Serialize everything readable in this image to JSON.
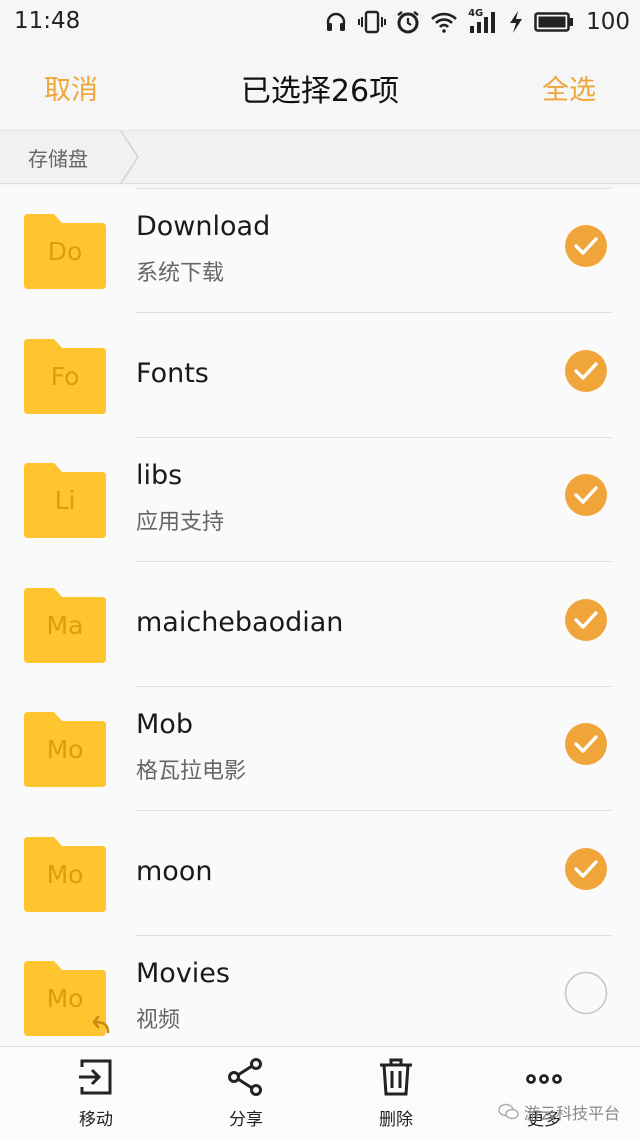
{
  "status": {
    "time": "11:48",
    "battery": "100",
    "network": "4G",
    "icons": [
      "headphones-icon",
      "vibrate-icon",
      "alarm-icon",
      "wifi-icon",
      "signal-icon",
      "charging-icon",
      "battery-icon"
    ]
  },
  "header": {
    "cancel": "取消",
    "title": "已选择26项",
    "select_all": "全选"
  },
  "breadcrumb": {
    "root": "存储盘"
  },
  "files": [
    {
      "abbr": "Do",
      "name": "Download",
      "subtitle": "系统下载",
      "checked": true
    },
    {
      "abbr": "Fo",
      "name": "Fonts",
      "subtitle": "",
      "checked": true
    },
    {
      "abbr": "Li",
      "name": "libs",
      "subtitle": "应用支持",
      "checked": true
    },
    {
      "abbr": "Ma",
      "name": "maichebaodian",
      "subtitle": "",
      "checked": true
    },
    {
      "abbr": "Mo",
      "name": "Mob",
      "subtitle": "格瓦拉电影",
      "checked": true
    },
    {
      "abbr": "Mo",
      "name": "moon",
      "subtitle": "",
      "checked": true
    },
    {
      "abbr": "Mo",
      "name": "Movies",
      "subtitle": "视频",
      "checked": false
    }
  ],
  "toolbar": {
    "move": "移动",
    "share": "分享",
    "delete": "删除",
    "more": "更多"
  },
  "watermark": "游云科技平台",
  "colors": {
    "accent": "#f0a53a",
    "folder": "#fec52e",
    "folder_text": "#e09a12",
    "check": "#f0a53a"
  }
}
